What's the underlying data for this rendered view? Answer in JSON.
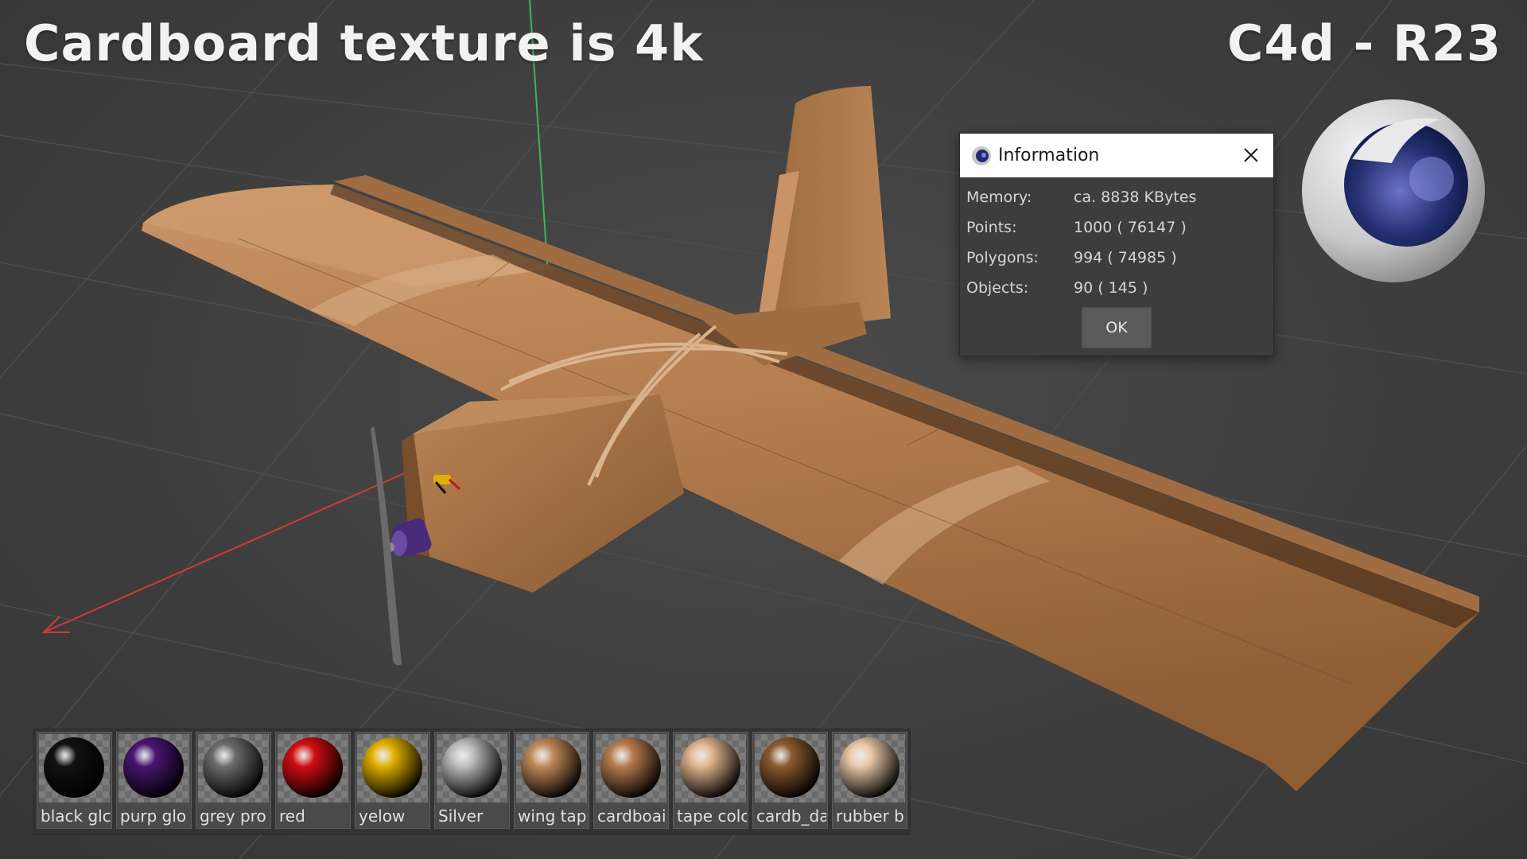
{
  "headline_left": "Cardboard texture is 4k",
  "headline_right": "C4d - R23",
  "info_dialog": {
    "title": "Information",
    "rows": [
      {
        "label": "Memory:",
        "value": "ca. 8838 KBytes"
      },
      {
        "label": "Points:",
        "value": "1000 ( 76147 )"
      },
      {
        "label": "Polygons:",
        "value": "994 ( 74985 )"
      },
      {
        "label": "Objects:",
        "value": "90 ( 145 )"
      }
    ],
    "ok_label": "OK"
  },
  "materials": [
    {
      "label": "black glc",
      "color": "#111111"
    },
    {
      "label": "purp glo",
      "color": "#4a1572"
    },
    {
      "label": "grey pro",
      "color": "#6b6b6b"
    },
    {
      "label": "red",
      "color": "#d10d12"
    },
    {
      "label": "yelow",
      "color": "#e0b000"
    },
    {
      "label": "Silver",
      "color": "#bdbdbd"
    },
    {
      "label": "wing tap",
      "color": "#c08a58"
    },
    {
      "label": "cardboai",
      "color": "#b77c4c"
    },
    {
      "label": "tape colc",
      "color": "#e0b58d"
    },
    {
      "label": "cardb_da",
      "color": "#8a5a2e"
    },
    {
      "label": "rubber b",
      "color": "#e8c7a5"
    }
  ],
  "colors": {
    "cardboard": "#b07a4c",
    "axis_x": "#d23a3a",
    "axis_y": "#3bb55a",
    "axis_z": "#3b6fd6"
  }
}
